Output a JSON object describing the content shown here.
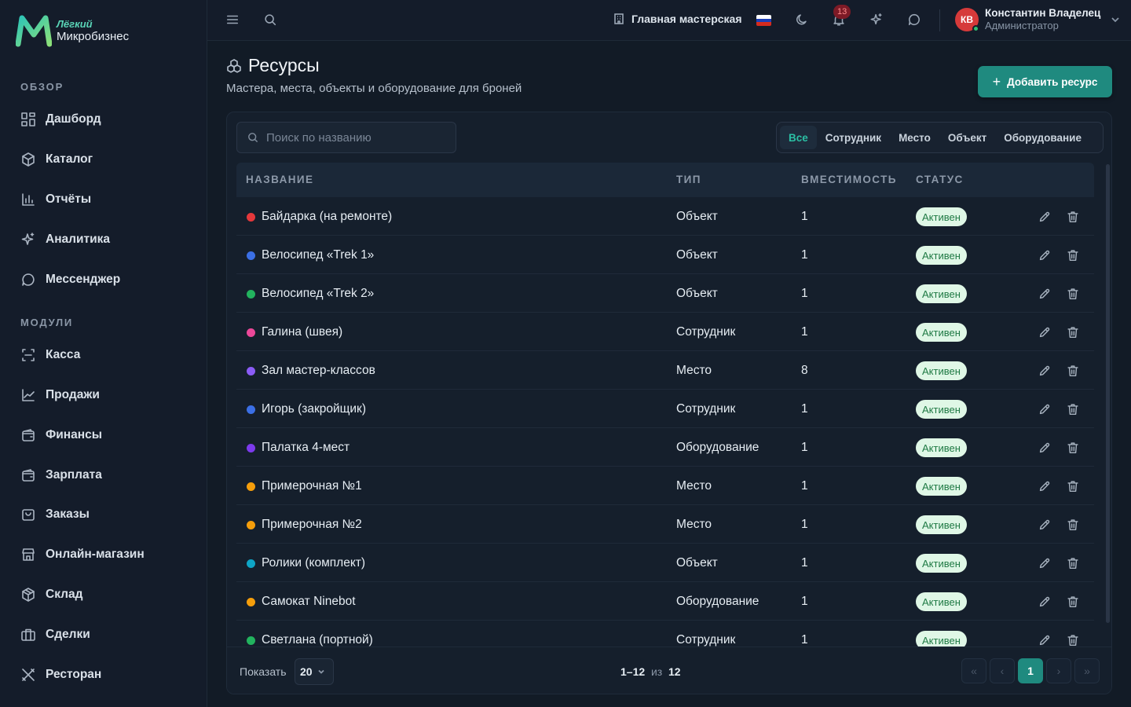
{
  "brand": {
    "top": "Лёгкий",
    "bottom": "Микробизнес",
    "accent": "#2bbfa4"
  },
  "sidebar": {
    "sections": [
      {
        "label": "ОБЗОР"
      },
      {
        "label": "МОДУЛИ"
      }
    ],
    "items": [
      {
        "label": "Дашборд",
        "icon": "grid-icon"
      },
      {
        "label": "Каталог",
        "icon": "package-icon"
      },
      {
        "label": "Отчёты",
        "icon": "bar-chart-icon"
      },
      {
        "label": "Аналитика",
        "icon": "sparkles-icon"
      },
      {
        "label": "Мессенджер",
        "icon": "chat-icon"
      },
      {
        "label": "Касса",
        "icon": "scan-icon"
      },
      {
        "label": "Продажи",
        "icon": "line-chart-icon"
      },
      {
        "label": "Финансы",
        "icon": "wallet-icon"
      },
      {
        "label": "Зарплата",
        "icon": "wallet-icon"
      },
      {
        "label": "Заказы",
        "icon": "shopping-bag-icon"
      },
      {
        "label": "Онлайн-магазин",
        "icon": "store-icon"
      },
      {
        "label": "Склад",
        "icon": "box-icon"
      },
      {
        "label": "Сделки",
        "icon": "briefcase-icon"
      },
      {
        "label": "Ресторан",
        "icon": "utensils-icon"
      }
    ]
  },
  "topbar": {
    "workshop": "Главная мастерская",
    "notifications_count": "13",
    "user": {
      "initials": "КВ",
      "name": "Константин Владелец",
      "role": "Администратор"
    }
  },
  "page": {
    "title": "Ресурсы",
    "subtitle": "Мастера, места, объекты и оборудование для броней",
    "add_button": "Добавить ресурс"
  },
  "search": {
    "placeholder": "Поиск по названию"
  },
  "filters": [
    "Все",
    "Сотрудник",
    "Место",
    "Объект",
    "Оборудование"
  ],
  "table": {
    "columns": [
      "НАЗВАНИЕ",
      "ТИП",
      "ВМЕСТИМОСТЬ",
      "СТАТУС"
    ],
    "rows": [
      {
        "name": "Байдарка (на ремонте)",
        "type": "Объект",
        "capacity": "1",
        "status": "Активен",
        "color": "#e5383b"
      },
      {
        "name": "Велосипед «Trek 1»",
        "type": "Объект",
        "capacity": "1",
        "status": "Активен",
        "color": "#3b6fe5"
      },
      {
        "name": "Велосипед «Trek 2»",
        "type": "Объект",
        "capacity": "1",
        "status": "Активен",
        "color": "#22b35e"
      },
      {
        "name": "Галина (швея)",
        "type": "Сотрудник",
        "capacity": "1",
        "status": "Активен",
        "color": "#ec4899"
      },
      {
        "name": "Зал мастер-классов",
        "type": "Место",
        "capacity": "8",
        "status": "Активен",
        "color": "#8b5cf6"
      },
      {
        "name": "Игорь (закройщик)",
        "type": "Сотрудник",
        "capacity": "1",
        "status": "Активен",
        "color": "#3b6fe5"
      },
      {
        "name": "Палатка 4-мест",
        "type": "Оборудование",
        "capacity": "1",
        "status": "Активен",
        "color": "#7c3aed"
      },
      {
        "name": "Примерочная №1",
        "type": "Место",
        "capacity": "1",
        "status": "Активен",
        "color": "#f59e0b"
      },
      {
        "name": "Примерочная №2",
        "type": "Место",
        "capacity": "1",
        "status": "Активен",
        "color": "#f59e0b"
      },
      {
        "name": "Ролики (комплект)",
        "type": "Объект",
        "capacity": "1",
        "status": "Активен",
        "color": "#0ea5c6"
      },
      {
        "name": "Самокат Ninebot",
        "type": "Оборудование",
        "capacity": "1",
        "status": "Активен",
        "color": "#f59e0b"
      },
      {
        "name": "Светлана (портной)",
        "type": "Сотрудник",
        "capacity": "1",
        "status": "Активен",
        "color": "#22b35e"
      }
    ]
  },
  "pagination": {
    "show_label": "Показать",
    "page_size": "20",
    "range": "1–12",
    "of": "из",
    "total": "12",
    "first": "«",
    "prev": "‹",
    "current": "1",
    "next": "›",
    "last": "»"
  }
}
